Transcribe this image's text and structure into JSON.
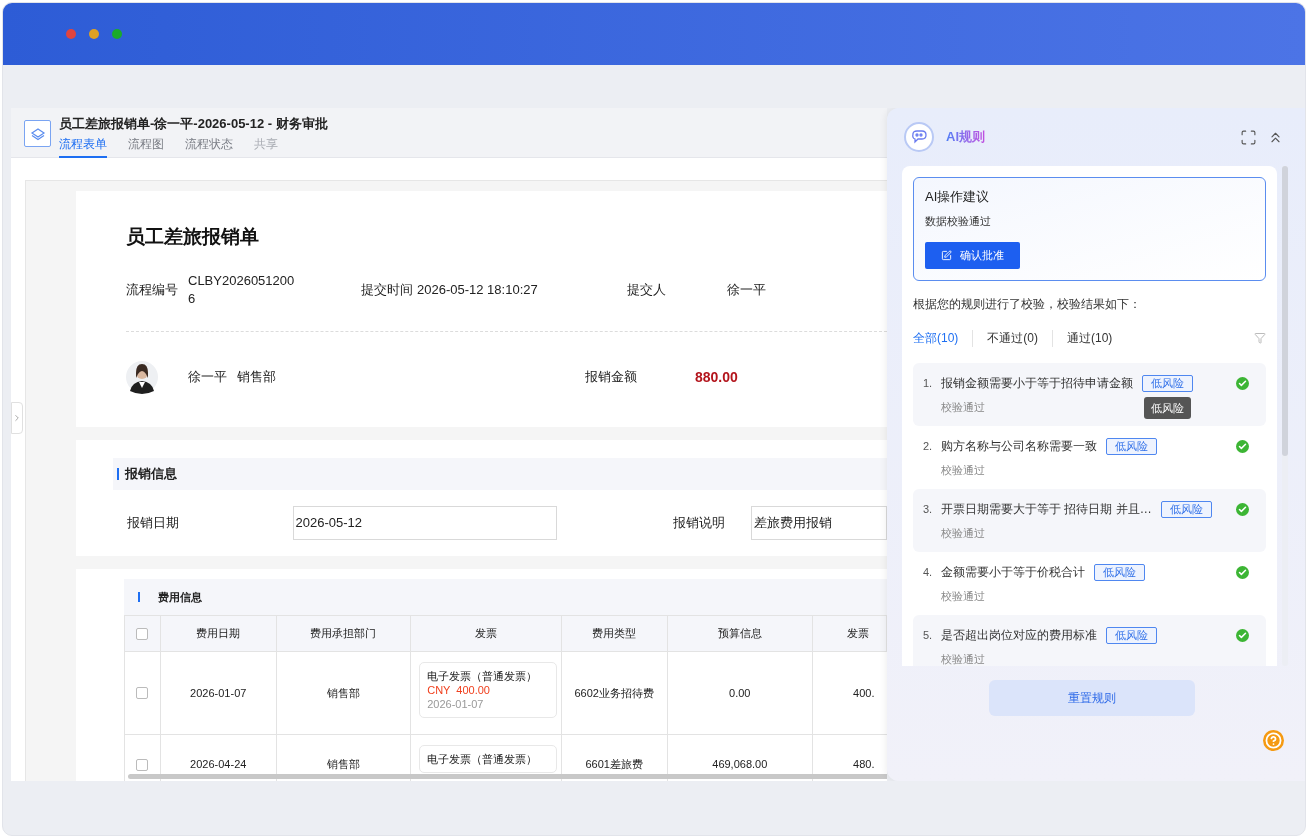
{
  "window": {
    "controls": [
      {
        "color": "#e0443e"
      },
      {
        "color": "#dea123"
      },
      {
        "color": "#1aab29"
      }
    ]
  },
  "document": {
    "title": "员工差旅报销单-徐一平-2026-05-12 - 财务审批",
    "tabs": [
      {
        "label": "流程表单",
        "selected": true,
        "disabled": false
      },
      {
        "label": "流程图",
        "selected": false,
        "disabled": false
      },
      {
        "label": "流程状态",
        "selected": false,
        "disabled": false
      },
      {
        "label": "共享",
        "selected": false,
        "disabled": true
      }
    ]
  },
  "form": {
    "title": "员工差旅报销单",
    "number_label": "流程编号",
    "number": "CLBY20260512006",
    "time_label": "提交时间",
    "time": "2026-05-12 18:10:27",
    "submitter_label": "提交人",
    "submitter": "徐一平",
    "person": {
      "name": "徐一平",
      "department": "销售部"
    },
    "amount_label": "报销金额",
    "amount": "880.00"
  },
  "reimbursement_info": {
    "title": "报销信息",
    "fields": [
      {
        "label": "报销日期",
        "value": "2026-05-12"
      },
      {
        "label": "报销说明",
        "value": "差旅费用报销"
      }
    ]
  },
  "expenses": {
    "title": "费用信息",
    "select_all_checked": false,
    "columns": [
      "费用日期",
      "费用承担部门",
      "发票",
      "费用类型",
      "预算信息",
      "发票"
    ],
    "rows": [
      {
        "checked": false,
        "date": "2026-01-07",
        "department": "销售部",
        "invoice": {
          "type": "电子发票（普通发票）",
          "amount": "CNY  400.00",
          "date": "2026-01-07"
        },
        "expense_type": "6602业务招待费",
        "budget": "0.00",
        "column_7": "400."
      },
      {
        "checked": false,
        "date": "2026-04-24",
        "department": "销售部",
        "invoice": {
          "type": "电子发票（普通发票）"
        },
        "expense_type": "6601差旅费",
        "budget": "469,068.00",
        "column_7": "480."
      }
    ]
  },
  "ai_panel": {
    "title": "AI规则",
    "suggestion": {
      "title": "AI操作建议",
      "text": "数据校验通过",
      "button": "确认批准"
    },
    "summary": "根据您的规则进行了校验，校验结果如下：",
    "filters": [
      {
        "label": "全部(10)",
        "selected": true
      },
      {
        "label": "不通过(0)",
        "selected": false
      },
      {
        "label": "通过(10)",
        "selected": false
      }
    ],
    "rules": [
      {
        "number": "1.",
        "text": "报销金额需要小于等于招待申请金额",
        "risk": "低风险",
        "passed": true,
        "result": "校验通过",
        "tooltip": "低风险"
      },
      {
        "number": "2.",
        "text": "购方名称与公司名称需要一致",
        "risk": "低风险",
        "passed": true,
        "result": "校验通过"
      },
      {
        "number": "3.",
        "text": "开票日期需要大于等于 招待日期 并且…",
        "risk": "低风险",
        "passed": true,
        "result": "校验通过"
      },
      {
        "number": "4.",
        "text": "金额需要小于等于价税合计",
        "risk": "低风险",
        "passed": true,
        "result": "校验通过"
      },
      {
        "number": "5.",
        "text": "是否超出岗位对应的费用标准",
        "risk": "低风险",
        "passed": true,
        "result": "校验通过"
      }
    ],
    "reset_button": "重置规则"
  }
}
